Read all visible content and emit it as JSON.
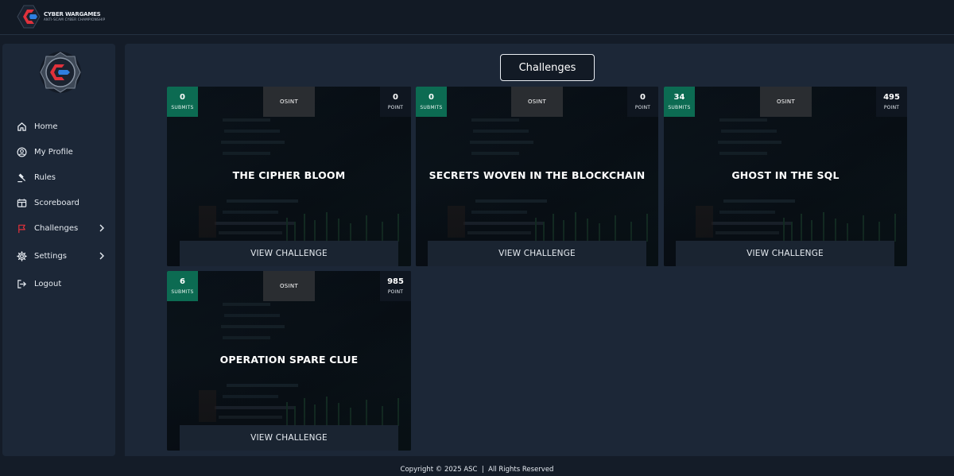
{
  "brand": {
    "title": "CYBER WARGAMES",
    "subtitle": "ANTI-SCAM CYBER CHAMPIONSHIP"
  },
  "sidebar": {
    "items": [
      {
        "label": "Home",
        "icon": "home-icon"
      },
      {
        "label": "My Profile",
        "icon": "user-circle-icon"
      },
      {
        "label": "Rules",
        "icon": "gavel-icon"
      },
      {
        "label": "Scoreboard",
        "icon": "scoreboard-icon"
      },
      {
        "label": "Challenges",
        "icon": "flag-icon",
        "accent": "#e0313b"
      },
      {
        "label": "Settings",
        "icon": "gear-icon"
      },
      {
        "label": "Logout",
        "icon": "logout-icon"
      }
    ]
  },
  "main": {
    "title": "Challenges",
    "submits_label": "SUBMITS",
    "point_label": "POINT",
    "view_label": "VIEW CHALLENGE",
    "cards": [
      {
        "submits": "0",
        "category": "OSINT",
        "points": "0",
        "title": "THE CIPHER BLOOM"
      },
      {
        "submits": "0",
        "category": "OSINT",
        "points": "0",
        "title": "SECRETS WOVEN IN THE BLOCKCHAIN"
      },
      {
        "submits": "34",
        "category": "OSINT",
        "points": "495",
        "title": "GHOST IN THE SQL"
      },
      {
        "submits": "6",
        "category": "OSINT",
        "points": "985",
        "title": "OPERATION SPARE CLUE"
      }
    ]
  },
  "footer": {
    "text": "Copyright © 2025 ASC  |  All Rights Reserved"
  },
  "colors": {
    "submits_green": "#0c6b52",
    "accent_red": "#e0313b",
    "accent_blue": "#2f7fe0",
    "panel": "#1c2737",
    "background": "#141c28"
  }
}
